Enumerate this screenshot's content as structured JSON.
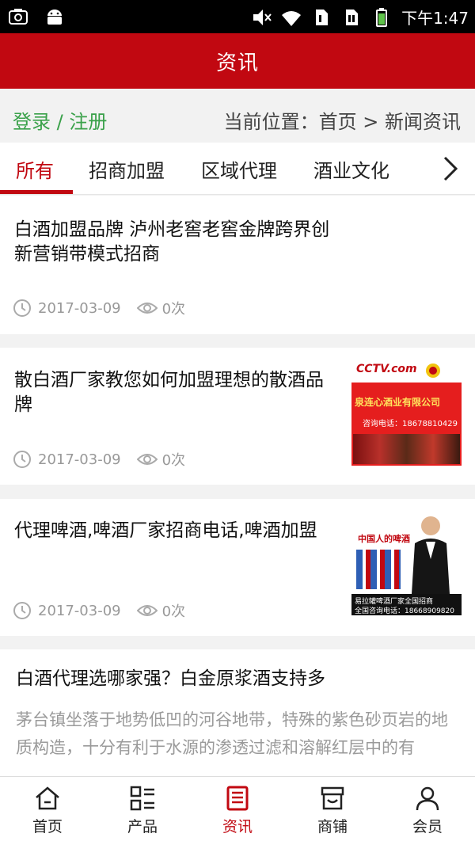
{
  "status_bar": {
    "time": "下午1:47",
    "left_icons": [
      "camera-icon",
      "android-icon"
    ],
    "right_icons": [
      "mute-icon",
      "wifi-icon",
      "sim1-icon",
      "sim2-icon",
      "battery-icon"
    ]
  },
  "app_bar": {
    "title": "资讯"
  },
  "location_bar": {
    "login_label": "登录 / 注册",
    "breadcrumb": "当前位置：首页 > 新闻资讯"
  },
  "tabs": {
    "items": [
      {
        "label": "所有",
        "active": true
      },
      {
        "label": "招商加盟",
        "active": false
      },
      {
        "label": "区域代理",
        "active": false
      },
      {
        "label": "酒业文化",
        "active": false
      }
    ],
    "more_icon": "chevron-right-icon"
  },
  "articles": [
    {
      "title": "白酒加盟品牌 泸州老窖老窖金牌跨界创新营销带模式招商",
      "date": "2017-03-09",
      "views": "0次"
    },
    {
      "title": "散白酒厂家教您如何加盟理想的散酒品牌",
      "date": "2017-03-09",
      "views": "0次",
      "thumb": {
        "brand_text": "CCTV.com",
        "company": "泉连心酒业有限公司",
        "phone": "咨询电话：18678810429"
      }
    },
    {
      "title": "代理啤酒,啤酒厂家招商电话,啤酒加盟",
      "date": "2017-03-09",
      "views": "0次",
      "thumb": {
        "slogan": "中国人的啤酒",
        "caption1": "易拉罐啤酒厂家全国招商",
        "caption2": "全国咨询电话：18668909820"
      }
    },
    {
      "title": "白酒代理选哪家强？白金原浆酒支持多",
      "snippet": "茅台镇坐落于地势低凹的河谷地带，特殊的紫色砂页岩的地质构造，十分有利于水源的渗透过滤和溶解红层中的有"
    }
  ],
  "bottom_nav": [
    {
      "label": "首页",
      "icon": "home-icon",
      "active": false
    },
    {
      "label": "产品",
      "icon": "grid-list-icon",
      "active": false
    },
    {
      "label": "资讯",
      "icon": "news-icon",
      "active": true
    },
    {
      "label": "商铺",
      "icon": "store-icon",
      "active": false
    },
    {
      "label": "会员",
      "icon": "user-icon",
      "active": false
    }
  ],
  "colors": {
    "brand_red": "#c10811",
    "login_green": "#3aa14a",
    "meta_gray": "#999999"
  }
}
